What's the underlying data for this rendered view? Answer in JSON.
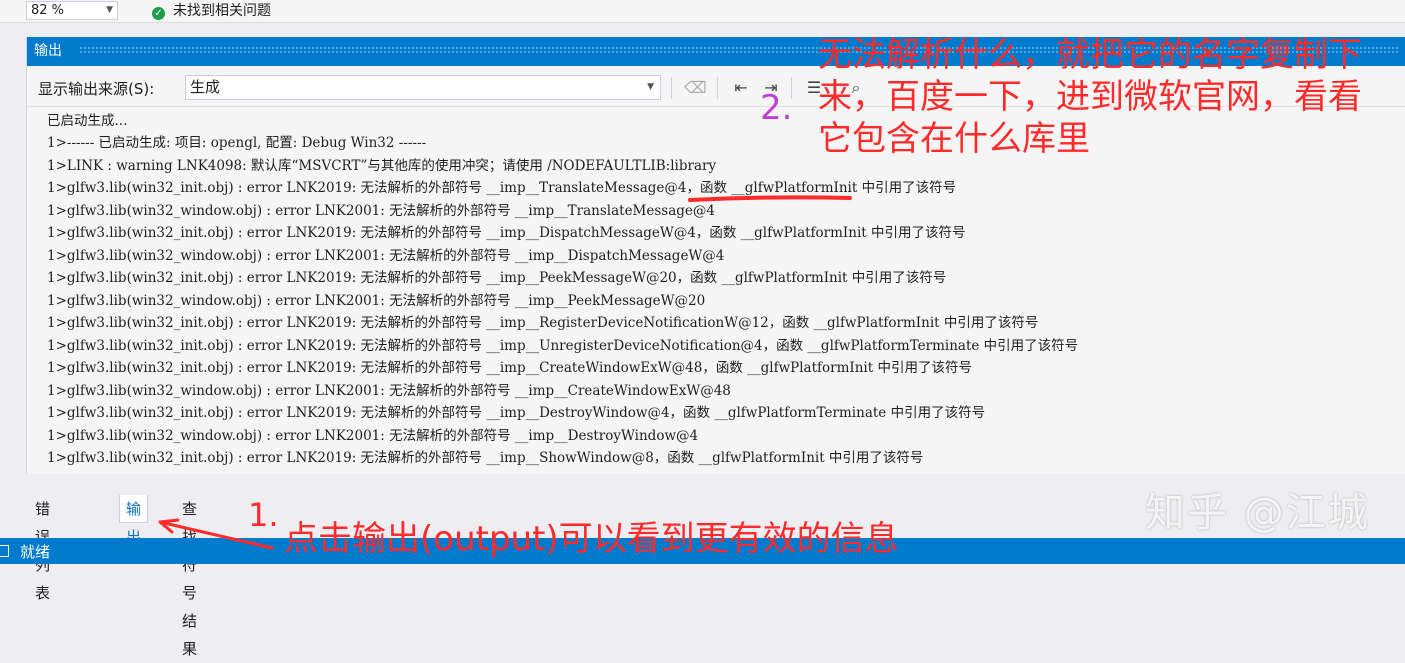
{
  "topbar": {
    "zoom": "82 %",
    "issues": "未找到相关问题"
  },
  "pane": {
    "title": "输出",
    "source_label": "显示输出来源(S):",
    "source_value": "生成",
    "toolbar_icons": [
      "clear-all-icon",
      "previous-message-icon",
      "next-message-icon",
      "toggle-word-wrap-icon",
      "find-icon"
    ]
  },
  "log": {
    "lines": [
      "已启动生成...",
      "1>------ 已启动生成: 项目: opengl, 配置: Debug Win32 ------",
      "1>LINK : warning LNK4098: 默认库“MSVCRT”与其他库的使用冲突；请使用 /NODEFAULTLIB:library",
      "1>glfw3.lib(win32_init.obj) : error LNK2019: 无法解析的外部符号 __imp__TranslateMessage@4，函数 __glfwPlatformInit 中引用了该符号",
      "1>glfw3.lib(win32_window.obj) : error LNK2001: 无法解析的外部符号 __imp__TranslateMessage@4",
      "1>glfw3.lib(win32_init.obj) : error LNK2019: 无法解析的外部符号 __imp__DispatchMessageW@4，函数 __glfwPlatformInit 中引用了该符号",
      "1>glfw3.lib(win32_window.obj) : error LNK2001: 无法解析的外部符号 __imp__DispatchMessageW@4",
      "1>glfw3.lib(win32_init.obj) : error LNK2019: 无法解析的外部符号 __imp__PeekMessageW@20，函数 __glfwPlatformInit 中引用了该符号",
      "1>glfw3.lib(win32_window.obj) : error LNK2001: 无法解析的外部符号 __imp__PeekMessageW@20",
      "1>glfw3.lib(win32_init.obj) : error LNK2019: 无法解析的外部符号 __imp__RegisterDeviceNotificationW@12，函数 __glfwPlatformInit 中引用了该符号",
      "1>glfw3.lib(win32_init.obj) : error LNK2019: 无法解析的外部符号 __imp__UnregisterDeviceNotification@4，函数 __glfwPlatformTerminate 中引用了该符号",
      "1>glfw3.lib(win32_init.obj) : error LNK2019: 无法解析的外部符号 __imp__CreateWindowExW@48，函数 __glfwPlatformInit 中引用了该符号",
      "1>glfw3.lib(win32_window.obj) : error LNK2001: 无法解析的外部符号 __imp__CreateWindowExW@48",
      "1>glfw3.lib(win32_init.obj) : error LNK2019: 无法解析的外部符号 __imp__DestroyWindow@4，函数 __glfwPlatformTerminate 中引用了该符号",
      "1>glfw3.lib(win32_window.obj) : error LNK2001: 无法解析的外部符号 __imp__DestroyWindow@4",
      "1>glfw3.lib(win32_init.obj) : error LNK2019: 无法解析的外部符号 __imp__ShowWindow@8，函数 __glfwPlatformInit 中引用了该符号"
    ]
  },
  "tabs": {
    "error_list": "错误列表",
    "output": "输出",
    "find_symbol": "查找符号结果"
  },
  "status": {
    "text": "就绪"
  },
  "annotations": {
    "note2_number": "2.",
    "note2_text": "无法解析什么，就把它的名字复制下\n来，百度一下，进到微软官网，看看\n它包含在什么库里",
    "note1_number": "1.",
    "note1_text": "点击输出(output)可以看到更有效的信息",
    "color": "#ff2a2a"
  },
  "watermark": "知乎 @江城",
  "colors": {
    "accent": "#007acc",
    "log_bg": "#f5f5f5"
  }
}
